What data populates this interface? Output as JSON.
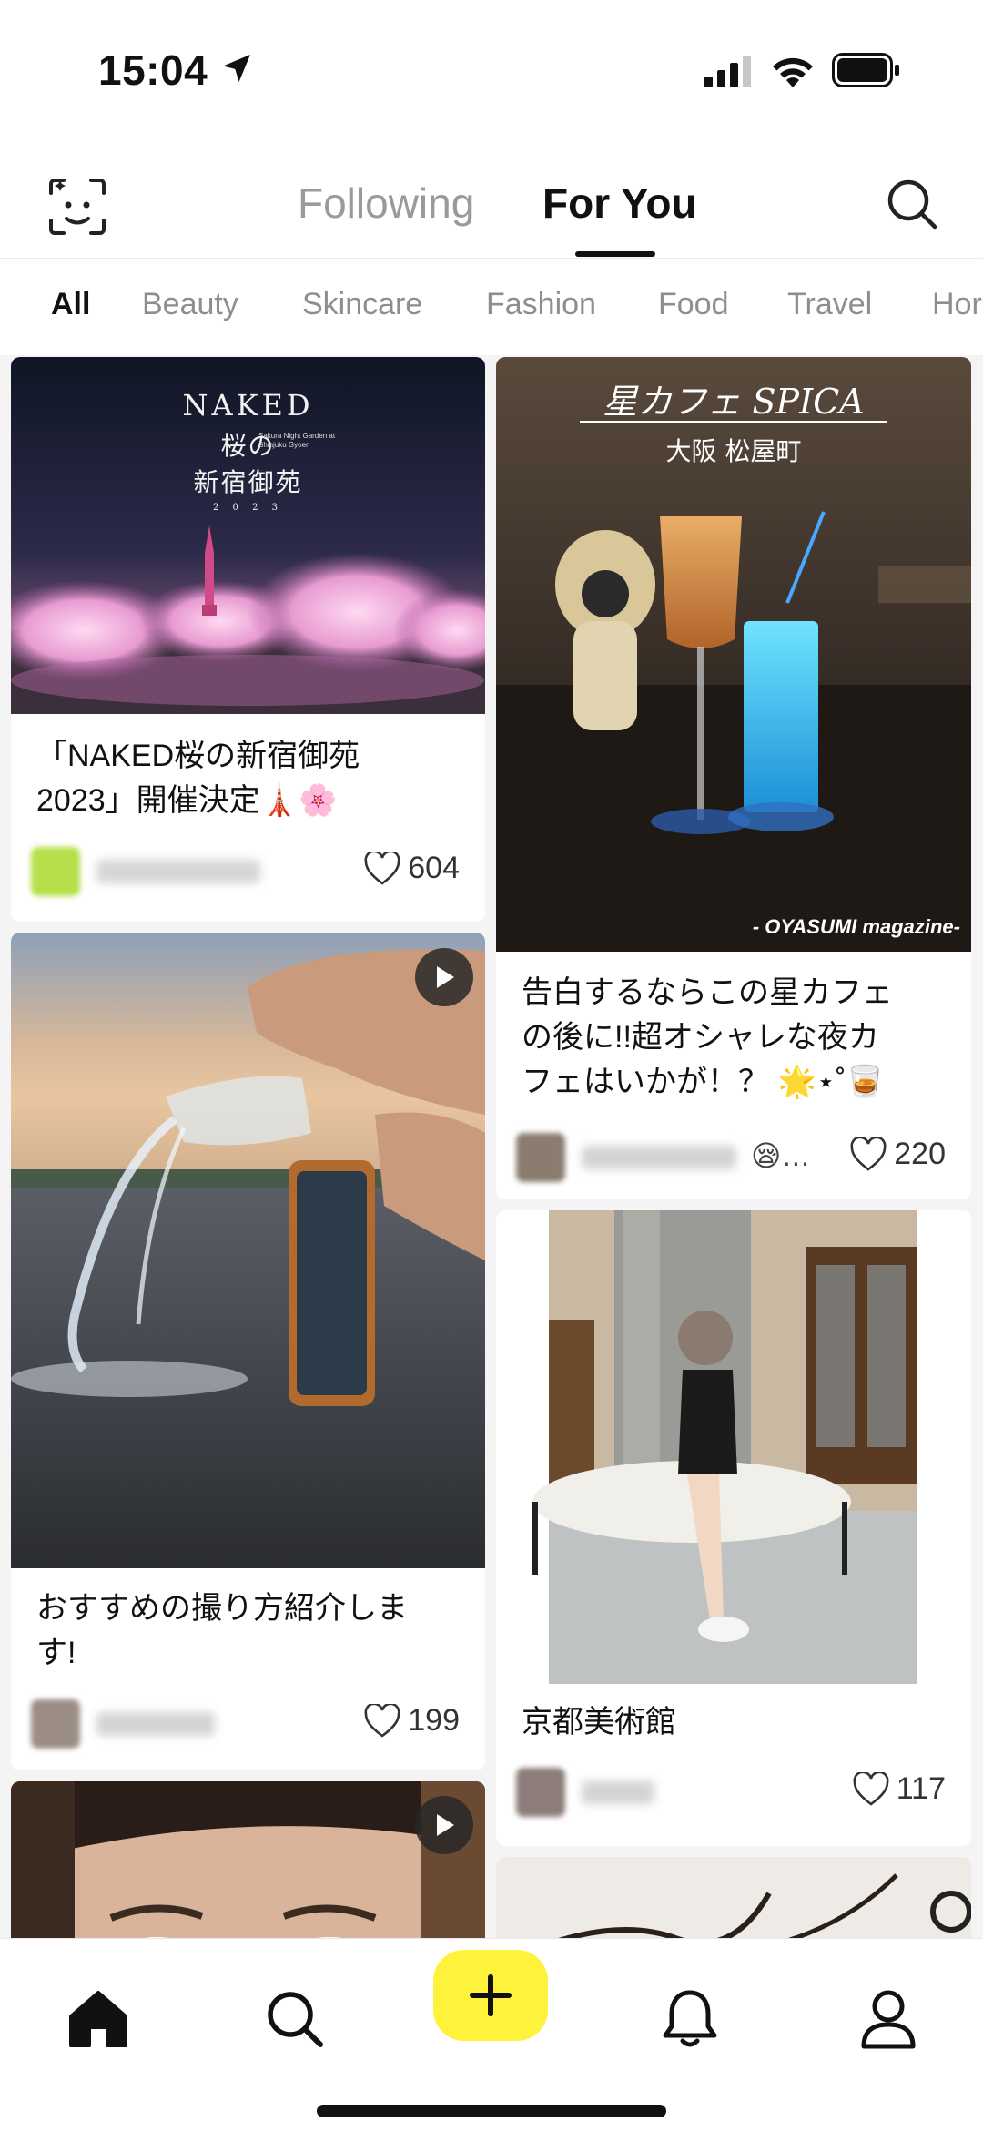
{
  "status_bar": {
    "time": "15:04"
  },
  "header": {
    "tabs": [
      {
        "label": "Following",
        "active": false
      },
      {
        "label": "For You",
        "active": true
      }
    ]
  },
  "categories": [
    {
      "label": "All",
      "active": true
    },
    {
      "label": "Beauty",
      "active": false
    },
    {
      "label": "Skincare",
      "active": false
    },
    {
      "label": "Fashion",
      "active": false
    },
    {
      "label": "Food",
      "active": false
    },
    {
      "label": "Travel",
      "active": false
    },
    {
      "label": "Hor",
      "active": false
    }
  ],
  "posts": {
    "naked": {
      "image_text": {
        "title": "NAKED",
        "line1": "桜の",
        "line2": "新宿御苑",
        "year": "2 0 2 3",
        "sub": "Sakura Night Garden at Shinjuku Gyoen"
      },
      "title_line1": "「NAKED桜の新宿御苑",
      "title_line2": "2023」開催決定🗼🌸",
      "likes": "604"
    },
    "spica": {
      "image_text": {
        "title": "星カフェ SPICA",
        "subtitle": "大阪 松屋町",
        "credit": "- OYASUMI magazine-"
      },
      "title_line1": "告白するならこの星カフェ",
      "title_line2": "の後に!!超オシャレな夜カ",
      "title_line3": "フェはいかが！？ 🌟⋆˚🥃",
      "user_suffix": "😪…",
      "likes": "220"
    },
    "water": {
      "title_line1": "おすすめの撮り方紹介しま",
      "title_line2": "す!",
      "likes": "199"
    },
    "museum": {
      "title_line1": "京都美術館",
      "likes": "117"
    }
  },
  "colors": {
    "accent_yellow": "#fff23a",
    "inactive_text": "#8e8e8e",
    "active_text": "#111111"
  },
  "icons": {
    "status": [
      "location-arrow-icon",
      "cellular-signal-icon",
      "wifi-icon",
      "battery-icon"
    ],
    "header": [
      "face-scan-icon",
      "search-icon"
    ],
    "nav": [
      "home-icon",
      "search-icon",
      "plus-icon",
      "bell-icon",
      "profile-icon"
    ]
  }
}
